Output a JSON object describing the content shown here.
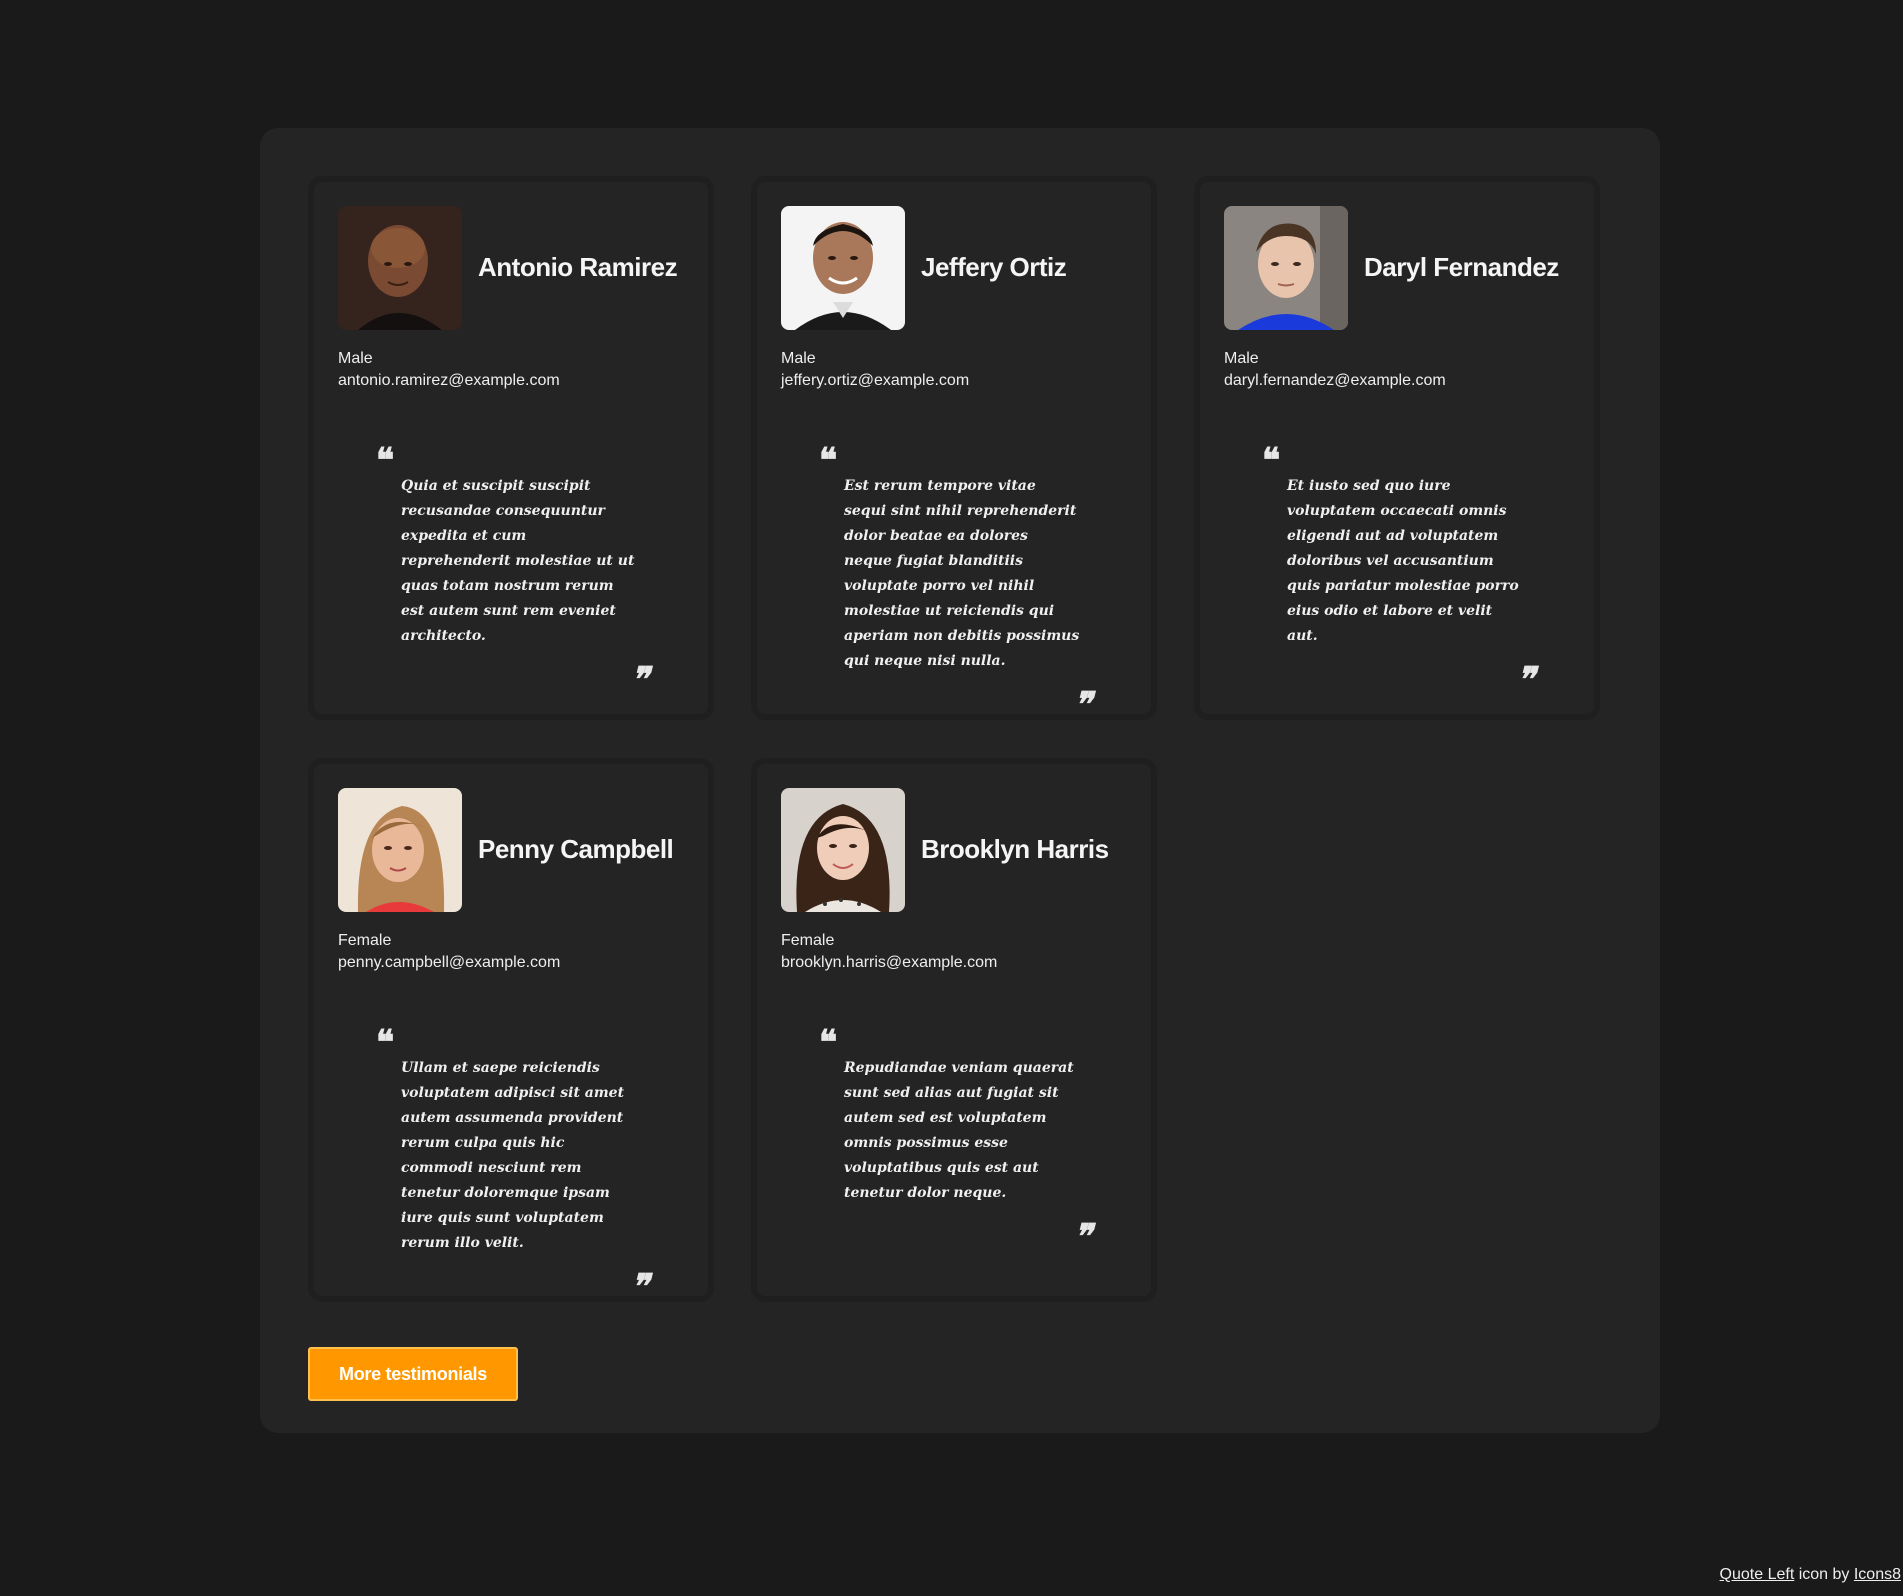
{
  "testimonials": [
    {
      "name": "Antonio Ramirez",
      "gender": "Male",
      "email": "antonio.ramirez@example.com",
      "quote": "Quia et suscipit suscipit recusandae consequuntur expedita et cum reprehenderit molestiae ut ut quas totam nostrum rerum est autem sunt rem eveniet architecto."
    },
    {
      "name": "Jeffery Ortiz",
      "gender": "Male",
      "email": "jeffery.ortiz@example.com",
      "quote": "Est rerum tempore vitae sequi sint nihil reprehenderit dolor beatae ea dolores neque fugiat blanditiis voluptate porro vel nihil molestiae ut reiciendis qui aperiam non debitis possimus qui neque nisi nulla."
    },
    {
      "name": "Daryl Fernandez",
      "gender": "Male",
      "email": "daryl.fernandez@example.com",
      "quote": "Et iusto sed quo iure voluptatem occaecati omnis eligendi aut ad voluptatem doloribus vel accusantium quis pariatur molestiae porro eius odio et labore et velit aut."
    },
    {
      "name": "Penny Campbell",
      "gender": "Female",
      "email": "penny.campbell@example.com",
      "quote": "Ullam et saepe reiciendis voluptatem adipisci sit amet autem assumenda provident rerum culpa quis hic commodi nesciunt rem tenetur doloremque ipsam iure quis sunt voluptatem rerum illo velit."
    },
    {
      "name": "Brooklyn Harris",
      "gender": "Female",
      "email": "brooklyn.harris@example.com",
      "quote": "Repudiandae veniam quaerat sunt sed alias aut fugiat sit autem sed est voluptatem omnis possimus esse voluptatibus quis est aut tenetur dolor neque."
    }
  ],
  "quote_marks": {
    "open": "❝",
    "close": "❞"
  },
  "more_button": {
    "label": "More testimonials",
    "color": "#ff9800"
  },
  "credit": {
    "link1": "Quote Left",
    "middle": " icon by ",
    "link2": "Icons8"
  },
  "colors": {
    "page_background": "#1a1a1a",
    "panel_background": "#242424",
    "card_border": "#1f1f1f"
  }
}
